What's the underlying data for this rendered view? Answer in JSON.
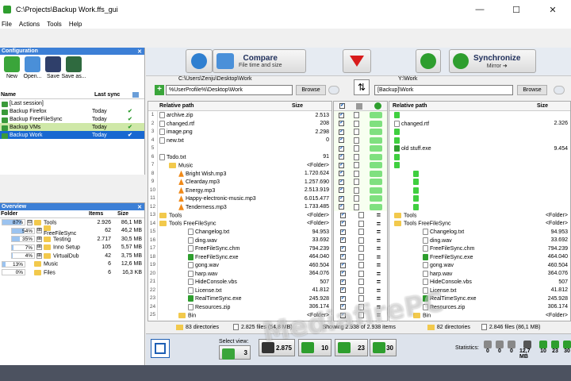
{
  "window": {
    "title": "C:\\Projects\\Backup Work.ffs_gui",
    "controls": [
      "—",
      "☐",
      "✕"
    ]
  },
  "menu": [
    "File",
    "Actions",
    "Tools",
    "Help"
  ],
  "config": {
    "header": "Configuration",
    "tools": [
      {
        "label": "New",
        "color": "#3aa53a"
      },
      {
        "label": "Open...",
        "color": "#4a8fd8"
      },
      {
        "label": "Save",
        "color": "#2f3f6a"
      },
      {
        "label": "Save as...",
        "color": "#2f6a3f"
      }
    ],
    "col_name": "Name",
    "col_last_sync": "Last sync",
    "rows": [
      {
        "name": "[Last session]",
        "last": "",
        "check": ""
      },
      {
        "name": "Backup Firefox",
        "last": "Today",
        "check": "✔"
      },
      {
        "name": "Backup FreeFileSync",
        "last": "Today",
        "check": "✔"
      },
      {
        "name": "Backup VMs",
        "last": "Today",
        "check": "✔"
      },
      {
        "name": "Backup Work",
        "last": "Today",
        "check": "✔"
      }
    ]
  },
  "overview": {
    "header": "Overview",
    "col_folder": "Folder",
    "col_items": "Items",
    "col_size": "Size",
    "rows": [
      {
        "pct": "87%",
        "frac": 0.87,
        "indent": 0,
        "exp": "⊟",
        "name": "Tools",
        "items": "2.926",
        "size": "86,1 MB"
      },
      {
        "pct": "54%",
        "frac": 0.54,
        "indent": 1,
        "exp": "⊞",
        "name": "FreeFileSync",
        "items": "62",
        "size": "46,2 MB"
      },
      {
        "pct": "35%",
        "frac": 0.35,
        "indent": 1,
        "exp": "⊞",
        "name": "Testing",
        "items": "2.717",
        "size": "30,5 MB"
      },
      {
        "pct": "7%",
        "frac": 0.07,
        "indent": 1,
        "exp": "⊞",
        "name": "Inno Setup",
        "items": "105",
        "size": "5,57 MB"
      },
      {
        "pct": "4%",
        "frac": 0.04,
        "indent": 1,
        "exp": "⊞",
        "name": "VirtualDub",
        "items": "42",
        "size": "3,75 MB"
      },
      {
        "pct": "13%",
        "frac": 0.13,
        "indent": 0,
        "exp": "",
        "name": "Music",
        "items": "6",
        "size": "12,6 MB"
      },
      {
        "pct": "0%",
        "frac": 0.0,
        "indent": 0,
        "exp": "",
        "name": "Files",
        "items": "6",
        "size": "16,3 KB"
      }
    ]
  },
  "compare": {
    "title": "Compare",
    "subtitle": "File time and size"
  },
  "synchronize": {
    "title": "Synchronize",
    "subtitle": "Mirror ➜"
  },
  "left_path": {
    "label": "C:\\Users\\Zenju\\Desktop\\Work",
    "value": "%UserProfile%\\Desktop\\Work",
    "browse": "Browse"
  },
  "right_path": {
    "label": "Y:\\Work",
    "value": "[Backup]\\Work",
    "browse": "Browse"
  },
  "grid": {
    "col_path": "Relative path",
    "col_size": "Size",
    "left": [
      {
        "n": "1",
        "name": "archive.zip",
        "size": "2.513",
        "ind": 0,
        "t": "file"
      },
      {
        "n": "2",
        "name": "changed.rtf",
        "size": "208",
        "ind": 0,
        "t": "file"
      },
      {
        "n": "3",
        "name": "image.png",
        "size": "2.298",
        "ind": 0,
        "t": "file"
      },
      {
        "n": "4",
        "name": "new.txt",
        "size": "0",
        "ind": 0,
        "t": "file"
      },
      {
        "n": "5",
        "name": "",
        "size": "",
        "ind": 0,
        "t": "none"
      },
      {
        "n": "6",
        "name": "Todo.txt",
        "size": "91",
        "ind": 0,
        "t": "file"
      },
      {
        "n": "7",
        "name": "Music",
        "size": "<Folder>",
        "ind": 1,
        "t": "folder"
      },
      {
        "n": "8",
        "name": "Bright Wish.mp3",
        "size": "1.720.624",
        "ind": 2,
        "t": "mp3"
      },
      {
        "n": "9",
        "name": "Clearday.mp3",
        "size": "1.257.690",
        "ind": 2,
        "t": "mp3"
      },
      {
        "n": "10",
        "name": "Energy.mp3",
        "size": "2.513.919",
        "ind": 2,
        "t": "mp3"
      },
      {
        "n": "11",
        "name": "Happy-electronic-music.mp3",
        "size": "6.015.477",
        "ind": 2,
        "t": "mp3"
      },
      {
        "n": "12",
        "name": "Tenderness.mp3",
        "size": "1.733.485",
        "ind": 2,
        "t": "mp3"
      },
      {
        "n": "13",
        "name": "Tools",
        "size": "<Folder>",
        "ind": 0,
        "t": "folder"
      },
      {
        "n": "14",
        "name": "Tools  FreeFileSync",
        "size": "<Folder>",
        "ind": 0,
        "t": "folder"
      },
      {
        "n": "15",
        "name": "Changelog.txt",
        "size": "94.953",
        "ind": 3,
        "t": "file"
      },
      {
        "n": "16",
        "name": "ding.wav",
        "size": "33.692",
        "ind": 3,
        "t": "file"
      },
      {
        "n": "17",
        "name": "FreeFileSync.chm",
        "size": "794.239",
        "ind": 3,
        "t": "file"
      },
      {
        "n": "18",
        "name": "FreeFileSync.exe",
        "size": "464.040",
        "ind": 3,
        "t": "exe"
      },
      {
        "n": "19",
        "name": "gong.wav",
        "size": "460.504",
        "ind": 3,
        "t": "file"
      },
      {
        "n": "20",
        "name": "harp.wav",
        "size": "364.076",
        "ind": 3,
        "t": "file"
      },
      {
        "n": "21",
        "name": "HideConsole.vbs",
        "size": "507",
        "ind": 3,
        "t": "file"
      },
      {
        "n": "22",
        "name": "License.txt",
        "size": "41.812",
        "ind": 3,
        "t": "file"
      },
      {
        "n": "23",
        "name": "RealTimeSync.exe",
        "size": "245.928",
        "ind": 3,
        "t": "exe"
      },
      {
        "n": "24",
        "name": "Resources.zip",
        "size": "306.174",
        "ind": 3,
        "t": "file"
      },
      {
        "n": "25",
        "name": "Bin",
        "size": "<Folder>",
        "ind": 2,
        "t": "folder"
      }
    ],
    "right": [
      {
        "name": "",
        "size": "",
        "ind": 0,
        "t": "plus"
      },
      {
        "name": "changed.rtf",
        "size": "2.326",
        "ind": 0,
        "t": "file"
      },
      {
        "name": "",
        "size": "",
        "ind": 0,
        "t": "plus"
      },
      {
        "name": "",
        "size": "",
        "ind": 0,
        "t": "plus"
      },
      {
        "name": "old stuff.exe",
        "size": "9.454",
        "ind": 0,
        "t": "exe"
      },
      {
        "name": "",
        "size": "",
        "ind": 0,
        "t": "plus"
      },
      {
        "name": "",
        "size": "",
        "ind": 0,
        "t": "plus"
      },
      {
        "name": "",
        "size": "",
        "ind": 2,
        "t": "plus"
      },
      {
        "name": "",
        "size": "",
        "ind": 2,
        "t": "plus"
      },
      {
        "name": "",
        "size": "",
        "ind": 2,
        "t": "plus"
      },
      {
        "name": "",
        "size": "",
        "ind": 2,
        "t": "plus"
      },
      {
        "name": "",
        "size": "",
        "ind": 2,
        "t": "plus"
      },
      {
        "name": "Tools",
        "size": "<Folder>",
        "ind": 0,
        "t": "folder"
      },
      {
        "name": "Tools  FreeFileSync",
        "size": "<Folder>",
        "ind": 0,
        "t": "folder"
      },
      {
        "name": "Changelog.txt",
        "size": "94.953",
        "ind": 3,
        "t": "file"
      },
      {
        "name": "ding.wav",
        "size": "33.692",
        "ind": 3,
        "t": "file"
      },
      {
        "name": "FreeFileSync.chm",
        "size": "794.239",
        "ind": 3,
        "t": "file"
      },
      {
        "name": "FreeFileSync.exe",
        "size": "464.040",
        "ind": 3,
        "t": "exe"
      },
      {
        "name": "gong.wav",
        "size": "460.504",
        "ind": 3,
        "t": "file"
      },
      {
        "name": "harp.wav",
        "size": "364.076",
        "ind": 3,
        "t": "file"
      },
      {
        "name": "HideConsole.vbs",
        "size": "507",
        "ind": 3,
        "t": "file"
      },
      {
        "name": "License.txt",
        "size": "41.812",
        "ind": 3,
        "t": "file"
      },
      {
        "name": "RealTimeSync.exe",
        "size": "245.928",
        "ind": 3,
        "t": "exe"
      },
      {
        "name": "Resources.zip",
        "size": "306.174",
        "ind": 3,
        "t": "file"
      },
      {
        "name": "Bin",
        "size": "<Folder>",
        "ind": 2,
        "t": "folder"
      }
    ],
    "middle": [
      "act",
      "act",
      "act",
      "act",
      "act",
      "act",
      "act",
      "act",
      "act",
      "act",
      "act",
      "act",
      "eq",
      "eq",
      "eq",
      "eq",
      "eq",
      "eq",
      "eq",
      "eq",
      "eq",
      "eq",
      "eq",
      "eq",
      "eq"
    ]
  },
  "status": {
    "left": "83 directories",
    "left_files": "2.825 files (54,8 MB)",
    "mid": "Showing 2.938 of 2.938 items",
    "right": "82 directories",
    "right_files": "2.846 files (86,1 MB)"
  },
  "bottom": {
    "select_view": "Select view:",
    "counts": [
      {
        "value": "3",
        "color": "#3aa53a"
      },
      {
        "value": "2.875",
        "color": "#333333"
      },
      {
        "value": "10",
        "color": "#2e9e2e"
      },
      {
        "value": "23",
        "color": "#2e9e2e"
      },
      {
        "value": "30",
        "color": "#2e9e2e"
      }
    ],
    "statistics": "Statistics:",
    "stats": [
      "0",
      "0",
      "0",
      "12,7 MB",
      "10",
      "23",
      "30"
    ]
  },
  "watermark": "MediafirePC",
  "colors": {
    "accent": "#1868d1",
    "panel_header": "#3c7fd6",
    "action_green": "#7fe07f"
  }
}
